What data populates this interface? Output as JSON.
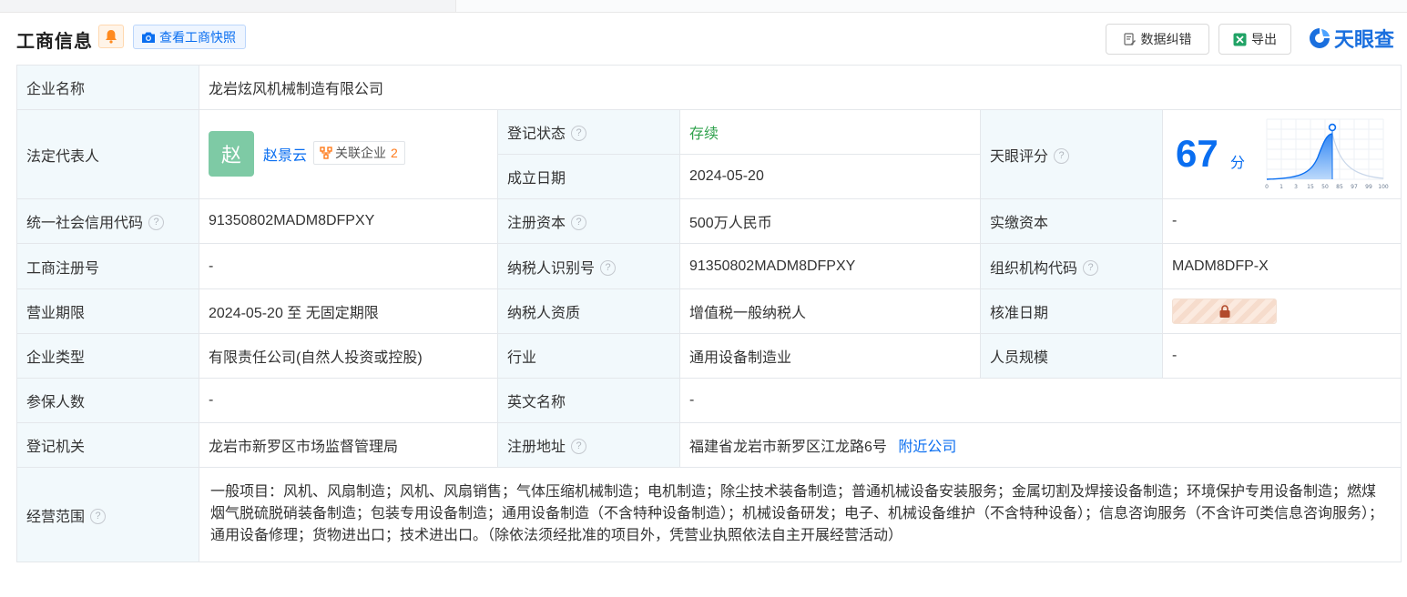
{
  "header": {
    "title": "工商信息",
    "snapshot_label": "查看工商快照",
    "correct_label": "数据纠错",
    "export_label": "导出",
    "logo_text": "天眼查"
  },
  "colors": {
    "accent": "#0a6ef0",
    "label_bg": "#f2f9fc",
    "status_green": "#2fa14c",
    "avatar": "#7ecaa5",
    "count_orange": "#ff7a1a"
  },
  "company_name_label": "企业名称",
  "company_name": "龙岩炫风机械制造有限公司",
  "legal_rep": {
    "label": "法定代表人",
    "avatar_char": "赵",
    "name": "赵景云",
    "related_label": "关联企业",
    "related_count": "2"
  },
  "reg_status": {
    "label": "登记状态",
    "value": "存续"
  },
  "established": {
    "label": "成立日期",
    "value": "2024-05-20"
  },
  "tianyan_score": {
    "label": "天眼评分",
    "score": "67",
    "unit": "分",
    "score_value": 67,
    "chart_ticks": [
      "0",
      "1",
      "3",
      "15",
      "50",
      "85",
      "97",
      "99",
      "100"
    ]
  },
  "credit_code": {
    "label": "统一社会信用代码",
    "value": "91350802MADM8DFPXY"
  },
  "reg_capital": {
    "label": "注册资本",
    "value": "500万人民币"
  },
  "paid_capital": {
    "label": "实缴资本",
    "value": "-"
  },
  "reg_no": {
    "label": "工商注册号",
    "value": "-"
  },
  "taxpayer_id": {
    "label": "纳税人识别号",
    "value": "91350802MADM8DFPXY"
  },
  "org_code": {
    "label": "组织机构代码",
    "value": "MADM8DFP-X"
  },
  "term": {
    "label": "营业期限",
    "value": "2024-05-20 至 无固定期限"
  },
  "taxpayer_type": {
    "label": "纳税人资质",
    "value": "增值税一般纳税人"
  },
  "approval_date": {
    "label": "核准日期"
  },
  "company_type": {
    "label": "企业类型",
    "value": "有限责任公司(自然人投资或控股)"
  },
  "industry": {
    "label": "行业",
    "value": "通用设备制造业"
  },
  "staff_size": {
    "label": "人员规模",
    "value": "-"
  },
  "insured": {
    "label": "参保人数",
    "value": "-"
  },
  "english_name": {
    "label": "英文名称",
    "value": "-"
  },
  "authority": {
    "label": "登记机关",
    "value": "龙岩市新罗区市场监督管理局"
  },
  "address": {
    "label": "注册地址",
    "value": "福建省龙岩市新罗区江龙路6号",
    "nearby": "附近公司"
  },
  "scope": {
    "label": "经营范围",
    "value": "一般项目：风机、风扇制造；风机、风扇销售；气体压缩机械制造；电机制造；除尘技术装备制造；普通机械设备安装服务；金属切割及焊接设备制造；环境保护专用设备制造；燃煤烟气脱硫脱硝装备制造；包装专用设备制造；通用设备制造（不含特种设备制造）；机械设备研发；电子、机械设备维护（不含特种设备）；信息咨询服务（不含许可类信息咨询服务）；通用设备修理；货物进出口；技术进出口。（除依法须经批准的项目外，凭营业执照依法自主开展经营活动）"
  }
}
